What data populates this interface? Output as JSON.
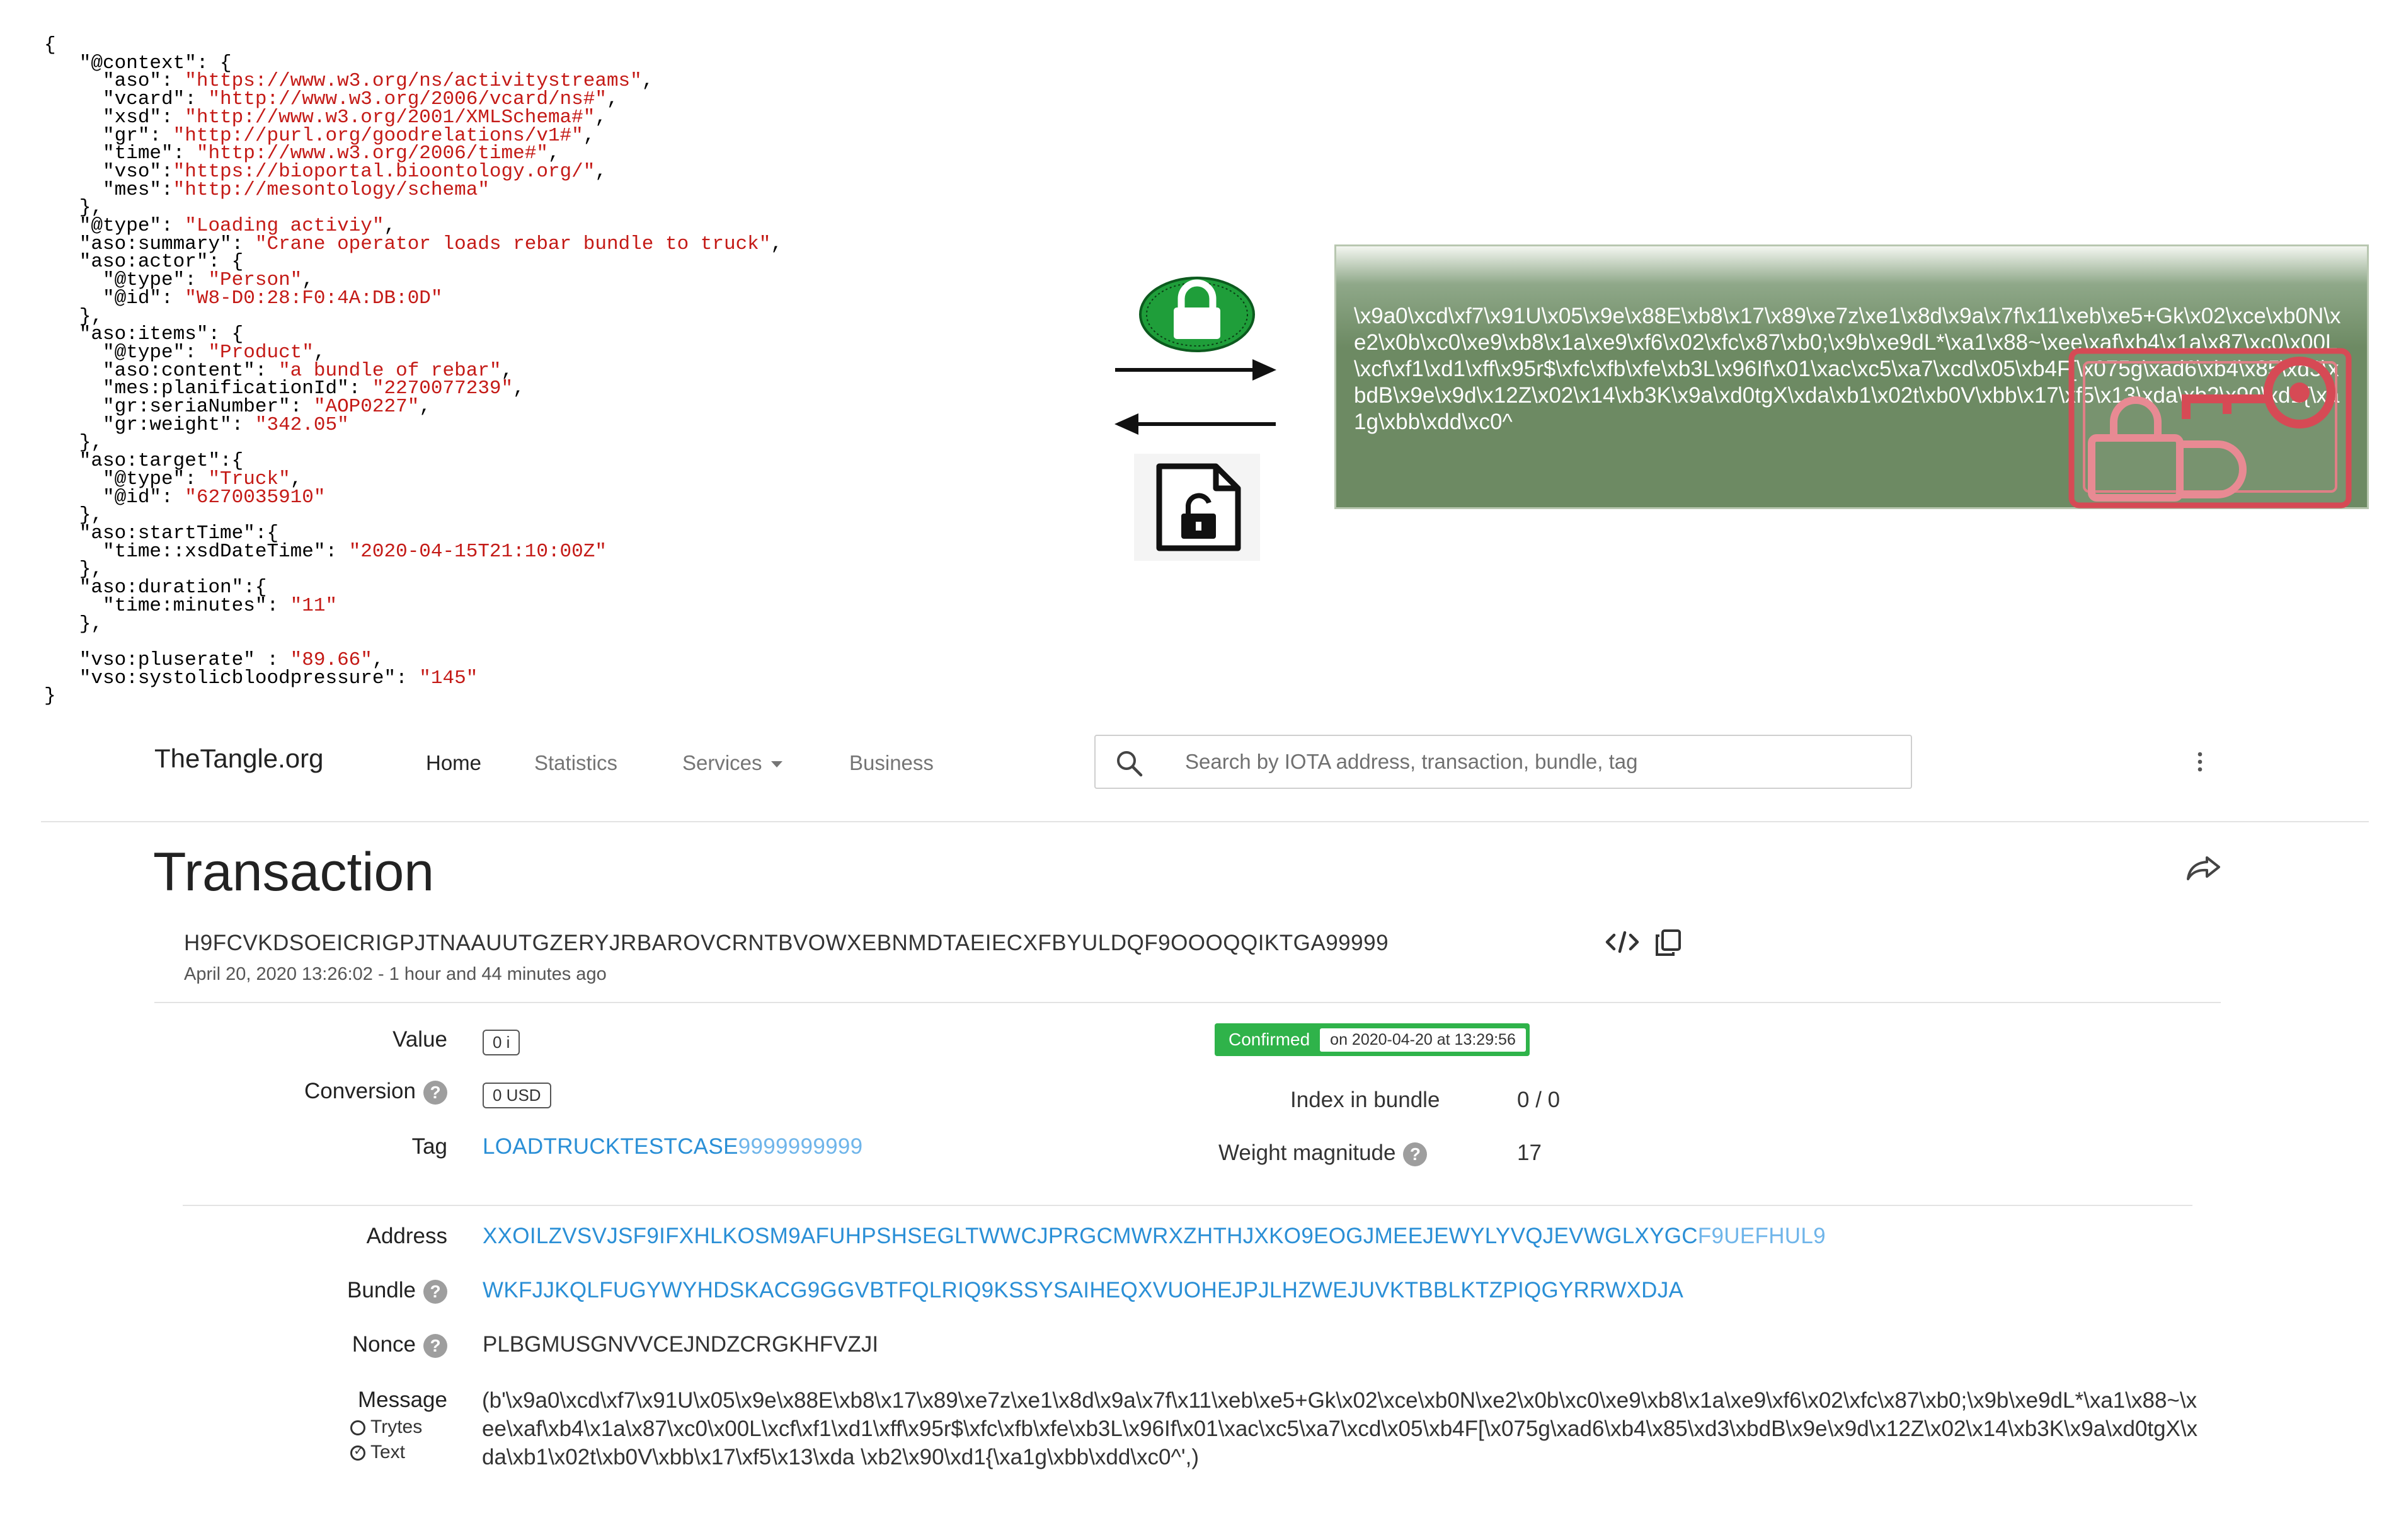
{
  "json_code": {
    "lines": [
      [
        [
          "k",
          "{"
        ]
      ],
      [
        [
          "k",
          "   \"@context\": {"
        ]
      ],
      [
        [
          "k",
          "     \"aso\": "
        ],
        [
          "s",
          "\"https://www.w3.org/ns/activitystreams\""
        ],
        [
          "k",
          ","
        ]
      ],
      [
        [
          "k",
          "     \"vcard\": "
        ],
        [
          "s",
          "\"http://www.w3.org/2006/vcard/ns#\""
        ],
        [
          "k",
          ","
        ]
      ],
      [
        [
          "k",
          "     \"xsd\": "
        ],
        [
          "s",
          "\"http://www.w3.org/2001/XMLSchema#\""
        ],
        [
          "k",
          ","
        ]
      ],
      [
        [
          "k",
          "     \"gr\": "
        ],
        [
          "s",
          "\"http://purl.org/goodrelations/v1#\""
        ],
        [
          "k",
          ","
        ]
      ],
      [
        [
          "k",
          "     \"time\": "
        ],
        [
          "s",
          "\"http://www.w3.org/2006/time#\""
        ],
        [
          "k",
          ","
        ]
      ],
      [
        [
          "k",
          "     \"vso\":"
        ],
        [
          "s",
          "\"https://bioportal.bioontology.org/\""
        ],
        [
          "k",
          ","
        ]
      ],
      [
        [
          "k",
          "     \"mes\":"
        ],
        [
          "s",
          "\"http://mesontology/schema\""
        ]
      ],
      [
        [
          "k",
          "   },"
        ]
      ],
      [
        [
          "k",
          "   \"@type\": "
        ],
        [
          "s",
          "\"Loading activiy\""
        ],
        [
          "k",
          ","
        ]
      ],
      [
        [
          "k",
          "   \"aso:summary\": "
        ],
        [
          "s",
          "\"Crane operator loads rebar bundle to truck\""
        ],
        [
          "k",
          ","
        ]
      ],
      [
        [
          "k",
          "   \"aso:actor\": {"
        ]
      ],
      [
        [
          "k",
          "     \"@type\": "
        ],
        [
          "s",
          "\"Person\""
        ],
        [
          "k",
          ","
        ]
      ],
      [
        [
          "k",
          "     \"@id\": "
        ],
        [
          "s",
          "\"W8-D0:28:F0:4A:DB:0D\""
        ]
      ],
      [
        [
          "k",
          "   },"
        ]
      ],
      [
        [
          "k",
          "   \"aso:items\": {"
        ]
      ],
      [
        [
          "k",
          "     \"@type\": "
        ],
        [
          "s",
          "\"Product\""
        ],
        [
          "k",
          ","
        ]
      ],
      [
        [
          "k",
          "     \"aso:content\": "
        ],
        [
          "s",
          "\"a bundle of rebar\""
        ],
        [
          "k",
          ","
        ]
      ],
      [
        [
          "k",
          "     \"mes:planificationId\": "
        ],
        [
          "s",
          "\"2270077239\""
        ],
        [
          "k",
          ","
        ]
      ],
      [
        [
          "k",
          "     \"gr:seriaNumber\": "
        ],
        [
          "s",
          "\"AOP0227\""
        ],
        [
          "k",
          ","
        ]
      ],
      [
        [
          "k",
          "     \"gr:weight\": "
        ],
        [
          "s",
          "\"342.05\""
        ]
      ],
      [
        [
          "k",
          "   },"
        ]
      ],
      [
        [
          "k",
          "   \"aso:target\":{"
        ]
      ],
      [
        [
          "k",
          "     \"@type\": "
        ],
        [
          "s",
          "\"Truck\""
        ],
        [
          "k",
          ","
        ]
      ],
      [
        [
          "k",
          "     \"@id\": "
        ],
        [
          "s",
          "\"6270035910\""
        ]
      ],
      [
        [
          "k",
          "   },"
        ]
      ],
      [
        [
          "k",
          "   \"aso:startTime\":{"
        ]
      ],
      [
        [
          "k",
          "     \"time::xsdDateTime\": "
        ],
        [
          "s",
          "\"2020-04-15T21:10:00Z\""
        ]
      ],
      [
        [
          "k",
          "   },"
        ]
      ],
      [
        [
          "k",
          "   \"aso:duration\":{"
        ]
      ],
      [
        [
          "k",
          "     \"time:minutes\": "
        ],
        [
          "s",
          "\"11\""
        ]
      ],
      [
        [
          "k",
          "   },"
        ]
      ],
      [
        [
          "k",
          ""
        ]
      ],
      [
        [
          "k",
          "   \"vso:pluserate\" : "
        ],
        [
          "s",
          "\"89.66\""
        ],
        [
          "k",
          ","
        ]
      ],
      [
        [
          "k",
          "   \"vso:systolicbloodpressure\": "
        ],
        [
          "s",
          "\"145\""
        ]
      ],
      [
        [
          "k",
          "}"
        ]
      ]
    ]
  },
  "diagram": {
    "cipher_text": "\\x9a0\\xcd\\xf7\\x91U\\x05\\x9e\\x88E\\xb8\\x17\\x89\\xe7z\\xe1\\x8d\\x9a\\x7f\\x11\\xeb\\xe5+Gk\\x02\\xce\\xb0N\\xe2\\x0b\\xc0\\xe9\\xb8\\x1a\\xe9\\xf6\\x02\\xfc\\x87\\xb0;\\x9b\\xe9dL*\\xa1\\x88~\\xee\\xaf\\xb4\\x1a\\x87\\xc0\\x00L\\xcf\\xf1\\xd1\\xff\\x95r$\\xfc\\xfb\\xfe\\xb3L\\x96If\\x01\\xac\\xc5\\xa7\\xcd\\x05\\xb4F[\\x075g\\xad6\\xb4\\x85\\xd3\\xbdB\\x9e\\x9d\\x12Z\\x02\\x14\\xb3K\\x9a\\xd0tgX\\xda\\xb1\\x02t\\xb0V\\xbb\\x17\\xf5\\x13\\xda\\xb2\\x90\\xd1{\\xa1g\\xbb\\xdd\\xc0^",
    "colors": {
      "cipher_bg": "#6d8a63",
      "lock_green": "#1f9e3a",
      "key_red": "#d64a55"
    }
  },
  "header": {
    "brand": "TheTangle.org",
    "nav": [
      {
        "label": "Home",
        "active": true
      },
      {
        "label": "Statistics",
        "active": false
      },
      {
        "label": "Services",
        "active": false
      },
      {
        "label": "Business",
        "active": false
      }
    ],
    "search_placeholder": "Search by IOTA address, transaction, bundle, tag"
  },
  "transaction": {
    "title": "Transaction",
    "hash": "H9FCVKDSOEICRIGPJTNAAUUTGZERYJRBAROVCRNTBVOWXEBNMDTAEIECXFBYULDQF9OOOQQIKTGA99999",
    "timestamp": "April 20, 2020 13:26:02 - 1 hour and 44 minutes ago",
    "value_label": "Value",
    "value": "0 i",
    "conversion_label": "Conversion",
    "conversion": "0 USD",
    "tag_label": "Tag",
    "tag_main": "LOADTRUCKTESTCASE",
    "tag_pad": "9999999999",
    "status": "Confirmed",
    "status_date": "on 2020-04-20 at 13:29:56",
    "index_label": "Index in bundle",
    "index": "0 / 0",
    "weight_label": "Weight magnitude",
    "weight": "17",
    "address_label": "Address",
    "address_main": "XXOILZVSVJSF9IFXHLKOSM9AFUHPSHSEGLTWWCJPRGCMWRXZHTHJXKO9EOGJMEEJEWYLYVQJEVWGLXYGC",
    "address_checksum": "F9UEFHUL9",
    "bundle_label": "Bundle",
    "bundle": "WKFJJKQLFUGYWYHDSKACG9GGVBTFQLRIQ9KSSYSAIHEQXVUOHEJPJLHZWEJUVKTBBLKTZPIQGYRRWXDJA",
    "nonce_label": "Nonce",
    "nonce": "PLBGMUSGNVVCEJNDZCRGKHFVZJI",
    "message_label": "Message",
    "message_opt_trytes": "Trytes",
    "message_opt_text": "Text",
    "message": "(b'\\x9a0\\xcd\\xf7\\x91U\\x05\\x9e\\x88E\\xb8\\x17\\x89\\xe7z\\xe1\\x8d\\x9a\\x7f\\x11\\xeb\\xe5+Gk\\x02\\xce\\xb0N\\xe2\\x0b\\xc0\\xe9\\xb8\\x1a\\xe9\\xf6\\x02\\xfc\\x87\\xb0;\\x9b\\xe9dL*\\xa1\\x88~\\xee\\xaf\\xb4\\x1a\\x87\\xc0\\x00L\\xcf\\xf1\\xd1\\xff\\x95r$\\xfc\\xfb\\xfe\\xb3L\\x96If\\x01\\xac\\xc5\\xa7\\xcd\\x05\\xb4F[\\x075g\\xad6\\xb4\\x85\\xd3\\xbdB\\x9e\\x9d\\x12Z\\x02\\x14\\xb3K\\x9a\\xd0tgX\\xda\\xb1\\x02t\\xb0V\\xbb\\x17\\xf5\\x13\\xda \\xb2\\x90\\xd1{\\xa1g\\xbb\\xdd\\xc0^',)"
  }
}
